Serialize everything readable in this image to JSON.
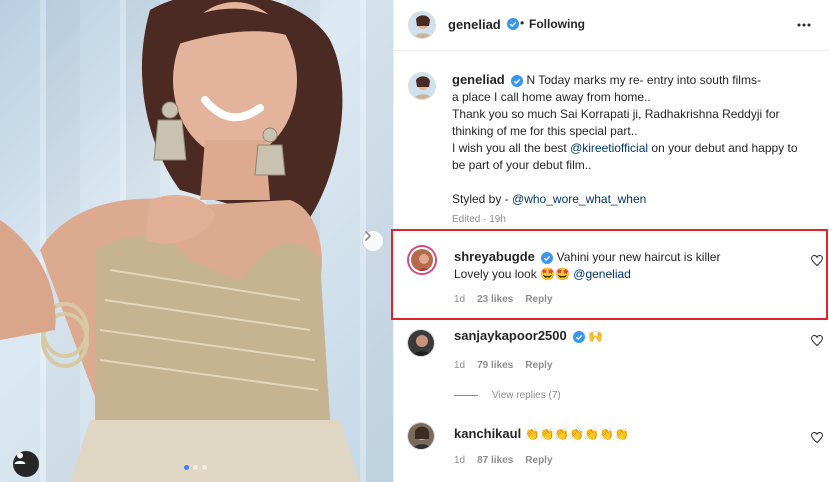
{
  "post": {
    "author": "geneliad",
    "follow_status": "Following",
    "separator": "•",
    "more_icon": "more-horizontal-icon",
    "caption": {
      "username": "geneliad",
      "lines": [
        "N Today marks my re- entry into south films-",
        "a place I call home away from home..",
        "Thank you so much Sai Korrapati ji, Radhakrishna Reddyji for",
        "thinking of me for this special part..",
        "I wish you all the best ",
        " on your debut and happy to",
        "be part of your debut film..",
        "Styled by - "
      ],
      "mention_kireeti": "@kireetiofficial",
      "mention_stylist": "@who_wore_what_when",
      "edited": "Edited · 19h"
    }
  },
  "comments": [
    {
      "username": "shreyabugde",
      "text_line1": "Vahini your new haircut is killer",
      "text_line2": "Lovely you look 🤩🤩 ",
      "mention": "@geneliad",
      "time": "1d",
      "likes": "23 likes",
      "reply": "Reply",
      "highlighted": true
    },
    {
      "username": "sanjaykapoor2500",
      "text": "🙌",
      "time": "1d",
      "likes": "79 likes",
      "reply": "Reply",
      "view_replies": "View replies (7)"
    },
    {
      "username": "kanchikaul",
      "text": "👏👏👏👏👏👏👏",
      "time": "1d",
      "likes": "87 likes",
      "reply": "Reply"
    }
  ],
  "colors": {
    "verified": "#3897f0",
    "highlight_border": "#e2232b",
    "link": "#00376b",
    "muted": "#8e8e8e"
  },
  "icons": [
    "verified-badge-icon",
    "heart-outline-icon",
    "chevron-right-icon",
    "user-tag-icon",
    "more-horizontal-icon"
  ]
}
